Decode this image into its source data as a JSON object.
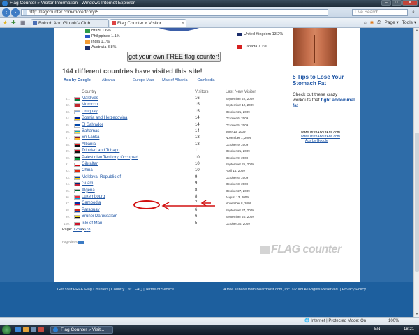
{
  "window": {
    "title": "Flag Counter » Visitor Information - Windows Internet Explorer",
    "buttons": [
      "–",
      "□",
      "✕"
    ]
  },
  "address": {
    "url": "http://flagcounter.com/more/fchry/5",
    "search_placeholder": "Live Search"
  },
  "tabs": [
    {
      "label": "Boidoh And Girdoh's Club ...",
      "active": false
    },
    {
      "label": "Flag Counter » Visitor I...",
      "active": true
    }
  ],
  "toolbar": {
    "page": "Page ▾",
    "tools": "Tools ▾"
  },
  "legend_left": [
    {
      "label": "Brazil 1.6%",
      "color": "#2e9b4a"
    },
    {
      "label": "Philippines 1.1%",
      "color": "#2a56c6"
    },
    {
      "label": "India 1.1%",
      "color": "#f39c34"
    },
    {
      "label": "Australia 3.8%",
      "color": "#1b2d6b"
    }
  ],
  "legend_right": [
    {
      "label": "United Kingdom 13.2%",
      "color": "#1b2d6b"
    },
    {
      "label": "Canada 7.1%",
      "color": "#d62020"
    }
  ],
  "get_button": "get your own FREE flag counter!",
  "heading": "144 different countries have visited this site!",
  "ad_links": [
    "Ads by Google",
    "Albania",
    "Europe Map",
    "Map of Albania",
    "Cambodia"
  ],
  "table": {
    "headers": {
      "country": "Country",
      "visitors": "Visitors",
      "last": "Last New Visitor"
    },
    "rows": [
      {
        "num": "81.",
        "country": "Maldives",
        "visitors": "16",
        "date": "September 22, 2009",
        "c1": "#d21034",
        "c2": "#007e3a"
      },
      {
        "num": "82.",
        "country": "Morocco",
        "visitors": "15",
        "date": "September 12, 2009",
        "c1": "#c1272d",
        "c2": "#c1272d"
      },
      {
        "num": "83.",
        "country": "Uruguay",
        "visitors": "15",
        "date": "October 21, 2009",
        "c1": "#7fa8e0",
        "c2": "#ffffff"
      },
      {
        "num": "84.",
        "country": "Bosnia and Herzegovina",
        "visitors": "14",
        "date": "October 6, 2009",
        "c1": "#002395",
        "c2": "#fecb00"
      },
      {
        "num": "85.",
        "country": "El Salvador",
        "visitors": "14",
        "date": "October 5, 2009",
        "c1": "#0047ab",
        "c2": "#ffffff"
      },
      {
        "num": "86.",
        "country": "Bahamas",
        "visitors": "14",
        "date": "June 13, 2009",
        "c1": "#00abc9",
        "c2": "#fae042"
      },
      {
        "num": "87.",
        "country": "Sri Lanka",
        "visitors": "13",
        "date": "November 1, 2009",
        "c1": "#8d153a",
        "c2": "#ffbe29"
      },
      {
        "num": "88.",
        "country": "Albania",
        "visitors": "13",
        "date": "October 9, 2009",
        "c1": "#e41e20",
        "c2": "#111111"
      },
      {
        "num": "89.",
        "country": "Trinidad and Tobago",
        "visitors": "11",
        "date": "October 21, 2009",
        "c1": "#ce1126",
        "c2": "#111111"
      },
      {
        "num": "90.",
        "country": "Palestinian Territory, Occupied",
        "visitors": "10",
        "date": "October 9, 2009",
        "c1": "#111111",
        "c2": "#009736"
      },
      {
        "num": "91.",
        "country": "Gibraltar",
        "visitors": "10",
        "date": "September 25, 2009",
        "c1": "#ffffff",
        "c2": "#da000c"
      },
      {
        "num": "92.",
        "country": "China",
        "visitors": "10",
        "date": "April 14, 2009",
        "c1": "#de2910",
        "c2": "#de2910"
      },
      {
        "num": "93.",
        "country": "Moldova, Republic of",
        "visitors": "9",
        "date": "October 6, 2009",
        "c1": "#0046ae",
        "c2": "#ffd200"
      },
      {
        "num": "94.",
        "country": "Guam",
        "visitors": "9",
        "date": "October 3, 2009",
        "c1": "#00297b",
        "c2": "#c62139"
      },
      {
        "num": "95.",
        "country": "Algeria",
        "visitors": "8",
        "date": "October 27, 2009",
        "c1": "#006233",
        "c2": "#ffffff"
      },
      {
        "num": "96.",
        "country": "Luxembourg",
        "visitors": "8",
        "date": "August 13, 2009",
        "c1": "#ed2939",
        "c2": "#00a1de"
      },
      {
        "num": "97.",
        "country": "Cambodia",
        "visitors": "7",
        "date": "November 8, 2009",
        "c1": "#032ea1",
        "c2": "#e00025"
      },
      {
        "num": "98.",
        "country": "Paraguay",
        "visitors": "6",
        "date": "September 27, 2009",
        "c1": "#d52b1e",
        "c2": "#0038a8"
      },
      {
        "num": "99.",
        "country": "Brunei Darussalam",
        "visitors": "6",
        "date": "September 20, 2009",
        "c1": "#f7e017",
        "c2": "#111111"
      },
      {
        "num": "100.",
        "country": "Isle of Man",
        "visitors": "5",
        "date": "October 30, 2009",
        "c1": "#cf142b",
        "c2": "#cf142b"
      }
    ]
  },
  "pagination": {
    "label": "Page:",
    "pages": [
      "1",
      "2",
      "3",
      "4",
      "5",
      "6",
      "7",
      "8"
    ]
  },
  "pageviews": "Pageviews",
  "logo": "FLAG counter",
  "ad": {
    "title": "5 Tips to Lose Your Stomach Fat",
    "body": "Check out these crazy workouts that",
    "body_bold": "fight abdominal fat",
    "url_a": "www.TruthAboutAbs.com",
    "url_b": "www.TruthAboutAbs.com",
    "url_c": "Ads by Google"
  },
  "footer": {
    "left": "Get Your FREE Flag Counter! | Country List | FAQ | Terms of Service",
    "right": "A free service from Boardhost.com, Inc. ©2009 All Rights Reserved. | Privacy Policy"
  },
  "status": {
    "zone": "Internet | Protected Mode: On",
    "zoom": "100%"
  },
  "taskbar": {
    "task": "Flag Counter » Visit...",
    "lang": "EN",
    "clock": "18:21"
  }
}
